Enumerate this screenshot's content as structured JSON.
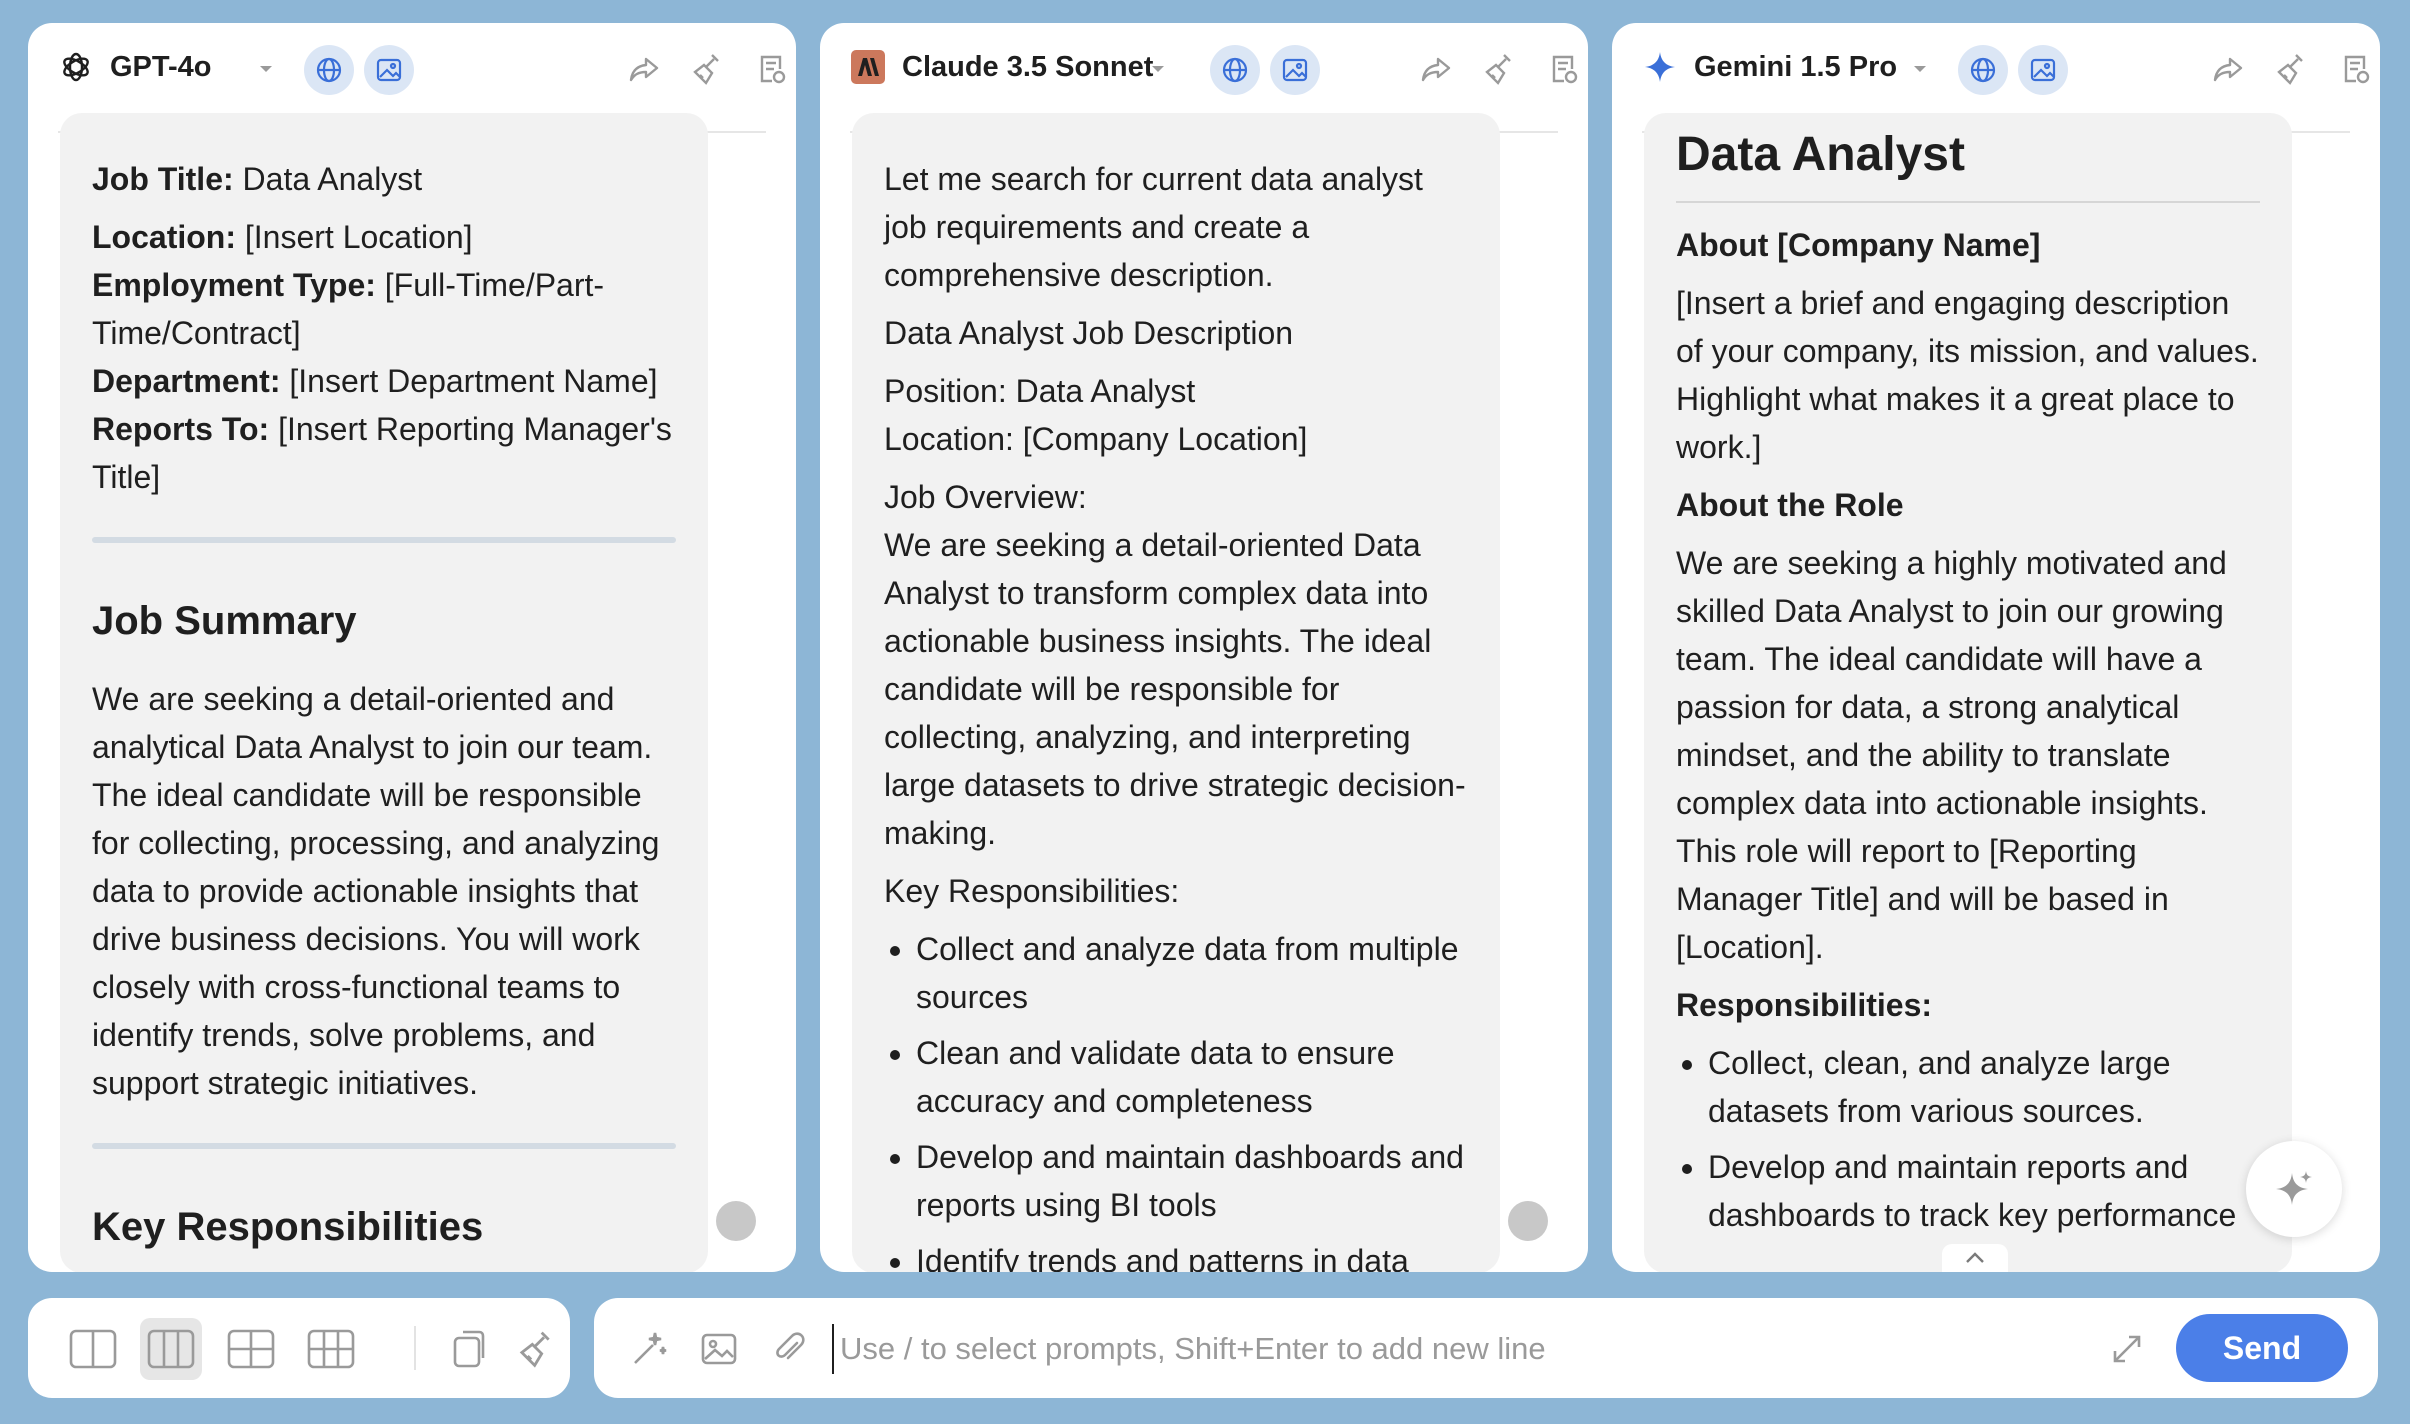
{
  "panels": [
    {
      "model": "GPT-4o",
      "content": {
        "job_title_label": "Job Title:",
        "job_title_value": "Data Analyst",
        "location_label": "Location:",
        "location_value": "[Insert Location]",
        "employment_label": "Employment Type:",
        "employment_value": "[Full-Time/Part-Time/Contract]",
        "department_label": "Department:",
        "department_value": "[Insert Department Name]",
        "reports_label": "Reports To:",
        "reports_value": "[Insert Reporting Manager's Title]",
        "summary_heading": "Job Summary",
        "summary_text": "We are seeking a detail-oriented and analytical Data Analyst to join our team. The ideal candidate will be responsible for collecting, processing, and analyzing data to provide actionable insights that drive business decisions. You will work closely with cross-functional teams to identify trends, solve problems, and support strategic initiatives.",
        "responsibilities_heading": "Key Responsibilities"
      }
    },
    {
      "model": "Claude 3.5 Sonnet",
      "content": {
        "intro": "Let me search for current data analyst job requirements and create a comprehensive description.",
        "doc_title": "Data Analyst Job Description",
        "position_line": "Position: Data Analyst",
        "location_line": "Location: [Company Location]",
        "overview_label": "Job Overview:",
        "overview_text": "We are seeking a detail-oriented Data Analyst to transform complex data into actionable business insights. The ideal candidate will be responsible for collecting, analyzing, and interpreting large datasets to drive strategic decision-making.",
        "responsibilities_label": "Key Responsibilities:",
        "bullets": [
          "Collect and analyze data from multiple sources",
          "Clean and validate data to ensure accuracy and completeness",
          "Develop and maintain dashboards and reports using BI tools",
          "Identify trends and patterns in data"
        ]
      }
    },
    {
      "model": "Gemini 1.5 Pro",
      "content": {
        "title": "Data Analyst",
        "about_company_heading": "About [Company Name]",
        "about_company_text": "[Insert a brief and engaging description of your company, its mission, and values. Highlight what makes it a great place to work.]",
        "about_role_heading": "About the Role",
        "about_role_text": "We are seeking a highly motivated and skilled Data Analyst to join our growing team. The ideal candidate will have a passion for data, a strong analytical mindset, and the ability to translate complex data into actionable insights. This role will report to [Reporting Manager Title] and will be based in [Location].",
        "responsibilities_heading": "Responsibilities:",
        "bullets": [
          "Collect, clean, and analyze large datasets from various sources.",
          "Develop and maintain reports and dashboards to track key performance"
        ]
      }
    }
  ],
  "input": {
    "placeholder": "Use / to select prompts, Shift+Enter to add new line"
  },
  "send_label": "Send",
  "colors": {
    "background": "#8db6d6",
    "accent": "#4b7fe8",
    "bubble": "#f2f2f2"
  }
}
